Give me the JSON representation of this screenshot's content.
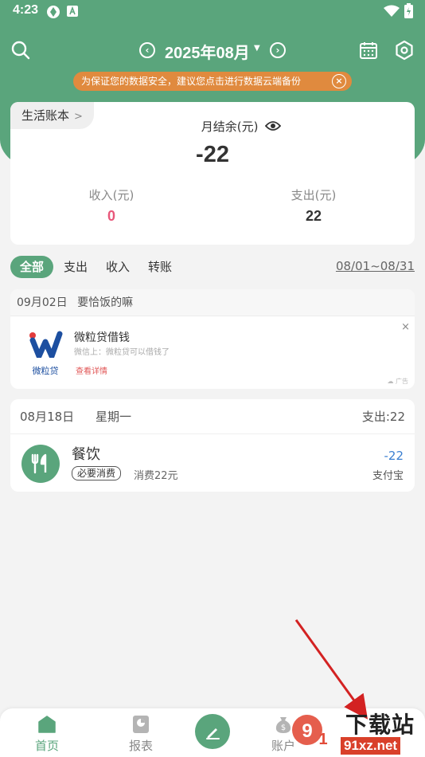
{
  "status_bar": {
    "time": "4:23"
  },
  "header": {
    "month": "2025年08月",
    "banner_text": "为保证您的数据安全，建议您点击进行数据云端备份",
    "banner_close": "×"
  },
  "summary": {
    "book_name": "生活账本",
    "balance_label": "月结余(元)",
    "balance_value": "-22",
    "income_label": "收入(元)",
    "income_value": "0",
    "expense_label": "支出(元)",
    "expense_value": "22"
  },
  "filters": {
    "tabs": [
      "全部",
      "支出",
      "收入",
      "转账"
    ],
    "active_index": 0,
    "date_range": "08/01~08/31"
  },
  "ad": {
    "header_date": "09月02日",
    "header_text": "要恰饭的嘛",
    "brand": "微粒贷",
    "title": "微粒贷借钱",
    "subtitle": "微信上：微粒贷可以借钱了",
    "link": "查看详情",
    "close": "×",
    "mark": "广告"
  },
  "day_group": {
    "date": "08月18日",
    "weekday": "星期一",
    "total": "支出:22",
    "entry": {
      "category": "餐饮",
      "tag": "必要消费",
      "note": "消费22元",
      "amount": "-22",
      "account": "支付宝"
    }
  },
  "bottom_nav": {
    "items": [
      {
        "label": "首页",
        "active": true
      },
      {
        "label": "报表",
        "active": false
      },
      {
        "label": "账户",
        "active": false
      }
    ]
  },
  "watermark": {
    "line1": "下载站",
    "line2": "91xz.net"
  },
  "colors": {
    "primary": "#5aa57c",
    "banner": "#e08a3e",
    "income": "#e8577a",
    "amount": "#3b7fd1",
    "arrow": "#d32222"
  }
}
